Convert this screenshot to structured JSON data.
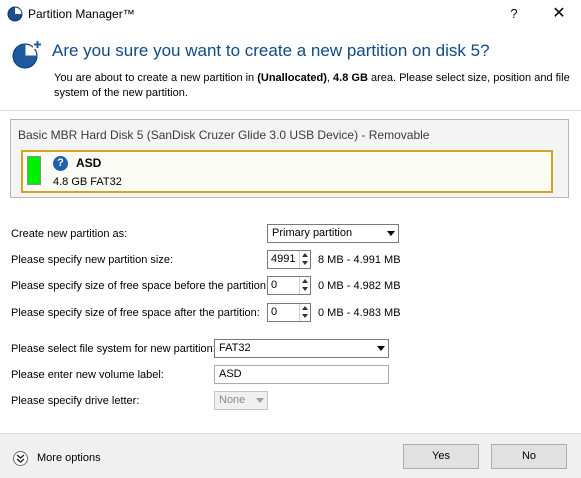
{
  "window": {
    "title": "Partition Manager™",
    "help_label": "?",
    "close_label": "✕"
  },
  "header": {
    "title": "Are you sure you want to create a new partition on disk 5?",
    "desc_pre": "You are about to create a new partition in ",
    "desc_area": "(Unallocated)",
    "desc_mid": ", ",
    "desc_size": "4.8 GB",
    "desc_post": " area. Please select size, position and file system of the new partition."
  },
  "disk": {
    "title": "Basic MBR Hard Disk 5 (SanDisk Cruzer Glide 3.0 USB Device) - Removable",
    "partition_color": "#00f000",
    "partition_help_label": "?",
    "partition_name": "ASD",
    "partition_info": "4.8 GB FAT32"
  },
  "form": {
    "create_as_label": "Create new partition as:",
    "create_as_value": "Primary partition",
    "size_label": "Please specify new partition size:",
    "size_value": "4991",
    "size_range": "8 MB - 4.991 MB",
    "before_label": "Please specify size of free space before the partition:",
    "before_value": "0",
    "before_range": "0 MB - 4.982 MB",
    "after_label": "Please specify size of free space after the partition:",
    "after_value": "0",
    "after_range": "0 MB - 4.983 MB",
    "fs_label": "Please select file system for new partition:",
    "fs_value": "FAT32",
    "volume_label": "Please enter new volume label:",
    "volume_value": "ASD",
    "drive_letter_label": "Please specify drive letter:",
    "drive_letter_value": "None"
  },
  "footer": {
    "more_options": "More options",
    "yes": "Yes",
    "no": "No"
  },
  "colors": {
    "title_blue": "#0e4a88",
    "highlight_border": "#d5a322"
  }
}
